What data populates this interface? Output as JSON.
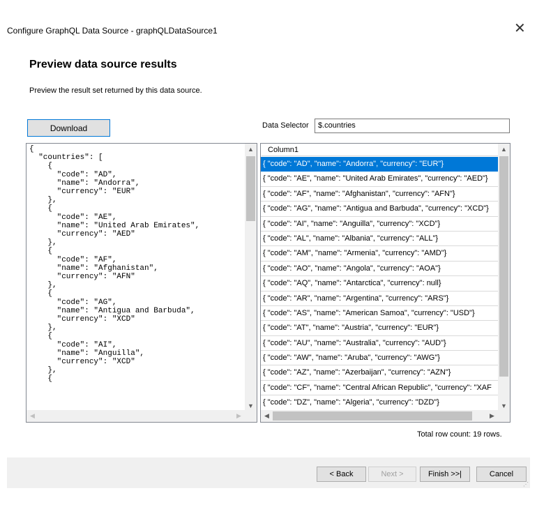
{
  "window": {
    "title": "Configure GraphQL Data Source - graphQLDataSource1",
    "close_glyph": "✕"
  },
  "page": {
    "heading": "Preview data source results",
    "description": "Preview the result set returned by this data source."
  },
  "toolbar": {
    "download_label": "Download",
    "selector_label": "Data Selector",
    "selector_value": "$.countries"
  },
  "json_preview": {
    "text": "{\n  \"countries\": [\n    {\n      \"code\": \"AD\",\n      \"name\": \"Andorra\",\n      \"currency\": \"EUR\"\n    },\n    {\n      \"code\": \"AE\",\n      \"name\": \"United Arab Emirates\",\n      \"currency\": \"AED\"\n    },\n    {\n      \"code\": \"AF\",\n      \"name\": \"Afghanistan\",\n      \"currency\": \"AFN\"\n    },\n    {\n      \"code\": \"AG\",\n      \"name\": \"Antigua and Barbuda\",\n      \"currency\": \"XCD\"\n    },\n    {\n      \"code\": \"AI\",\n      \"name\": \"Anguilla\",\n      \"currency\": \"XCD\"\n    },\n    {"
  },
  "grid": {
    "column_header": "Column1",
    "rows": [
      "{  \"code\": \"AD\",  \"name\": \"Andorra\",  \"currency\": \"EUR\"}",
      "{  \"code\": \"AE\",  \"name\": \"United Arab Emirates\",  \"currency\": \"AED\"}",
      "{  \"code\": \"AF\",  \"name\": \"Afghanistan\",  \"currency\": \"AFN\"}",
      "{  \"code\": \"AG\",  \"name\": \"Antigua and Barbuda\",  \"currency\": \"XCD\"}",
      "{  \"code\": \"AI\",  \"name\": \"Anguilla\",  \"currency\": \"XCD\"}",
      "{  \"code\": \"AL\",  \"name\": \"Albania\",  \"currency\": \"ALL\"}",
      "{  \"code\": \"AM\",  \"name\": \"Armenia\",  \"currency\": \"AMD\"}",
      "{  \"code\": \"AO\",  \"name\": \"Angola\",  \"currency\": \"AOA\"}",
      "{  \"code\": \"AQ\",  \"name\": \"Antarctica\",  \"currency\": null}",
      "{  \"code\": \"AR\",  \"name\": \"Argentina\",  \"currency\": \"ARS\"}",
      "{  \"code\": \"AS\",  \"name\": \"American Samoa\",  \"currency\": \"USD\"}",
      "{  \"code\": \"AT\",  \"name\": \"Austria\",  \"currency\": \"EUR\"}",
      "{  \"code\": \"AU\",  \"name\": \"Australia\",  \"currency\": \"AUD\"}",
      "{  \"code\": \"AW\",  \"name\": \"Aruba\",  \"currency\": \"AWG\"}",
      "{  \"code\": \"AZ\",  \"name\": \"Azerbaijan\",  \"currency\": \"AZN\"}",
      "{  \"code\": \"CF\",  \"name\": \"Central African Republic\",  \"currency\": \"XAF",
      "{  \"code\": \"DZ\",  \"name\": \"Algeria\",  \"currency\": \"DZD\"}"
    ],
    "selected_index": 0,
    "total_text": "Total row count: 19 rows."
  },
  "footer": {
    "back_label": "< Back",
    "next_label": "Next >",
    "finish_label": "Finish >>|",
    "cancel_label": "Cancel"
  },
  "icons": {
    "scroll_up": "▲",
    "scroll_down": "▼",
    "scroll_left": "◀",
    "scroll_right": "▶"
  },
  "colors": {
    "selection": "#0078d7",
    "footer_bg": "#f0f0f0"
  }
}
